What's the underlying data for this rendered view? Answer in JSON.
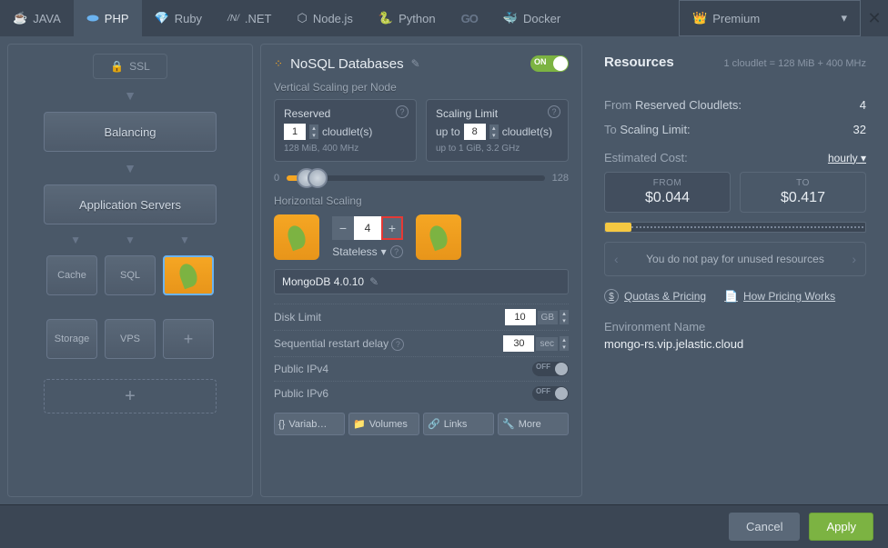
{
  "tabs": {
    "java": "JAVA",
    "php": "PHP",
    "ruby": "Ruby",
    "dotnet": ".NET",
    "nodejs": "Node.js",
    "python": "Python",
    "go": "GO",
    "docker": "Docker",
    "premium": "Premium"
  },
  "left": {
    "ssl": "SSL",
    "balancing": "Balancing",
    "app_servers": "Application Servers",
    "cache": "Cache",
    "sql": "SQL",
    "storage": "Storage",
    "vps": "VPS"
  },
  "middle": {
    "title": "NoSQL Databases",
    "toggle_on": "ON",
    "vertical_label": "Vertical Scaling per Node",
    "reserved": {
      "title": "Reserved",
      "value": "1",
      "unit": "cloudlet(s)",
      "info": "128 MiB, 400 MHz"
    },
    "limit": {
      "title": "Scaling Limit",
      "prefix": "up to",
      "value": "8",
      "unit": "cloudlet(s)",
      "info_prefix": "up to",
      "info": "1 GiB, 3.2 GHz"
    },
    "slider_min": "0",
    "slider_max": "128",
    "horizontal_label": "Horizontal Scaling",
    "hscale_value": "4",
    "stateless": "Stateless",
    "db_name": "MongoDB 4.0.10",
    "disk_limit": {
      "label": "Disk Limit",
      "value": "10",
      "unit": "GB"
    },
    "restart_delay": {
      "label": "Sequential restart delay",
      "value": "30",
      "unit": "sec"
    },
    "ipv4": {
      "label": "Public IPv4",
      "state": "OFF"
    },
    "ipv6": {
      "label": "Public IPv6",
      "state": "OFF"
    },
    "actions": {
      "variables": "Variab…",
      "volumes": "Volumes",
      "links": "Links",
      "more": "More"
    }
  },
  "right": {
    "title": "Resources",
    "subtitle": "1 cloudlet = 128 MiB + 400 MHz",
    "from_label": "From",
    "reserved_label": "Reserved Cloudlets:",
    "reserved_value": "4",
    "to_label": "To",
    "limit_label": "Scaling Limit:",
    "limit_value": "32",
    "cost_label": "Estimated Cost:",
    "cost_period": "hourly",
    "from_box": {
      "label": "FROM",
      "amount": "$0.044"
    },
    "to_box": {
      "label": "TO",
      "amount": "$0.417"
    },
    "carousel": "You do not pay for unused resources",
    "quotas": "Quotas & Pricing",
    "how_pricing": "How Pricing Works",
    "env_label": "Environment Name",
    "env_value": "mongo-rs.vip.jelastic.cloud"
  },
  "footer": {
    "cancel": "Cancel",
    "apply": "Apply"
  }
}
